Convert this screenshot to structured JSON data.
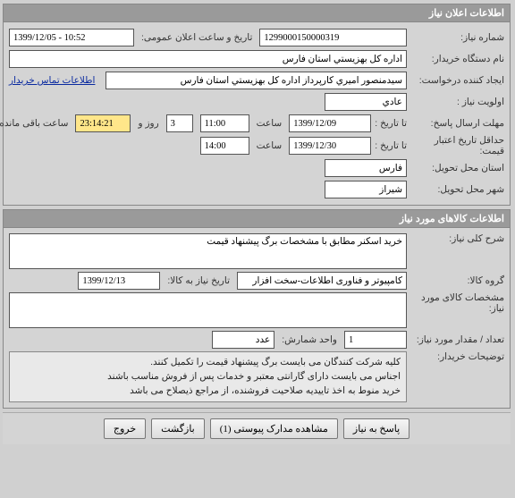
{
  "panel1": {
    "title": "اطلاعات اعلان نیاز",
    "niaz_no_label": "شماره نیاز:",
    "niaz_no": "1299000150000319",
    "public_announce_label": "تاریخ و ساعت اعلان عمومی:",
    "public_announce": "1399/12/05 - 10:52",
    "buyer_device_label": "نام دستگاه خریدار:",
    "buyer_device": "اداره كل بهزيستي استان فارس",
    "creator_label": "ایجاد کننده درخواست:",
    "creator": "سيدمنصور اميري کارپرداز اداره كل بهزيستي استان فارس",
    "contact_link": "اطلاعات تماس خریدار",
    "priority_label": "اولویت نیاز :",
    "priority": "عادي",
    "deadline_label": "مهلت ارسال پاسخ:",
    "ta_tarikh": "تا تاریخ :",
    "deadline_date": "1399/12/09",
    "saat": "ساعت",
    "deadline_time": "11:00",
    "days_remaining": "3",
    "rooz_va": "روز و",
    "time_remaining": "23:14:21",
    "remaining_suffix": "ساعت باقی مانده",
    "min_validity_label": "حداقل تاریخ اعتبار قیمت:",
    "min_validity_date": "1399/12/30",
    "min_validity_time": "14:00",
    "province_label": "استان محل تحویل:",
    "province": "فارس",
    "city_label": "شهر محل تحویل:",
    "city": "شيراز"
  },
  "panel2": {
    "title": "اطلاعات کالاهای مورد نیاز",
    "desc_label": "شرح کلی نیاز:",
    "desc": "خرید اسکنر مطابق با مشخصات برگ پیشنهاد قیمت",
    "group_label": "گروه کالا:",
    "group": "کامپیوتر و فناوری اطلاعات-سخت افزار",
    "req_by_label": "تاریخ نیاز به کالا:",
    "req_by": "1399/12/13",
    "specs_label": "مشخصات کالای مورد نیاز:",
    "specs": "",
    "qty_label": "تعداد / مقدار مورد نیاز:",
    "qty": "1",
    "unit_label": "واحد شمارش:",
    "unit": "عدد",
    "notes_label": "توضیحات خریدار:",
    "notes": "کلیه شرکت کنندگان می بایست برگ پیشنهاد قیمت را تکمیل کنند.\nاجناس می بایست دارای گارانتی معتبر و خدمات پس از فروش مناسب باشند\nخرید منوط به اخذ تاییدیه صلاحیت فروشنده، از مراجع ذیصلاح می باشد"
  },
  "actions": {
    "respond": "پاسخ به نیاز",
    "view_attach": "مشاهده مدارک پیوستی (1)",
    "back": "بازگشت",
    "exit": "خروج"
  }
}
